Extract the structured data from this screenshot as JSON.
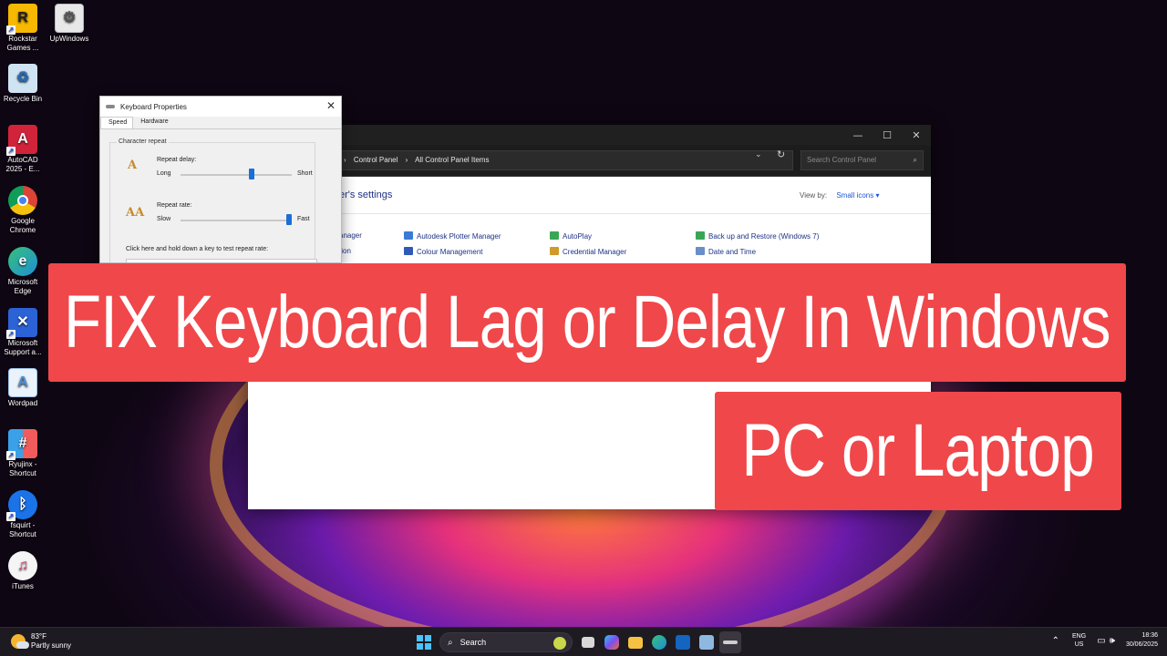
{
  "desktop": {
    "icons": [
      {
        "label": "Rockstar Games ...",
        "icon": "rockstar-icon",
        "color": "#f6b800"
      },
      {
        "label": "UpWindows",
        "icon": "gear-app-icon",
        "color": "#e8e8e8"
      },
      {
        "label": "Recycle Bin",
        "icon": "recycle-bin-icon",
        "color": "#cfe3f3"
      },
      {
        "label": "AutoCAD 2025 - E...",
        "icon": "autocad-icon",
        "color": "#d1243a"
      },
      {
        "label": "Google Chrome",
        "icon": "chrome-icon",
        "color": "#2fa44f"
      },
      {
        "label": "Microsoft Edge",
        "icon": "edge-icon",
        "color": "#1f8fd6"
      },
      {
        "label": "Microsoft Support a...",
        "icon": "tools-icon",
        "color": "#2b63d6"
      },
      {
        "label": "Wordpad",
        "icon": "wordpad-icon",
        "color": "#4b8fd6"
      },
      {
        "label": "Ryujinx - Shortcut",
        "icon": "ryujinx-icon",
        "color": "#3aa0e8"
      },
      {
        "label": "fsquirt - Shortcut",
        "icon": "bluetooth-icon",
        "color": "#1a73e8"
      },
      {
        "label": "iTunes",
        "icon": "itunes-icon",
        "color": "#f5f5f5"
      }
    ]
  },
  "control_panel": {
    "breadcrumbs": [
      "Control Panel",
      "All Control Panel Items"
    ],
    "search_placeholder": "Search Control Panel",
    "heading": "er's settings",
    "view_by_label": "View by:",
    "view_by_value": "Small icons",
    "items": [
      {
        "label": "anager",
        "icon": "none"
      },
      {
        "label": "Autodesk Plotter Manager",
        "icon": "plotter-icon",
        "color": "#3a7bd5"
      },
      {
        "label": "AutoPlay",
        "icon": "autoplay-icon",
        "color": "#3aa655"
      },
      {
        "label": "Back up and Restore (Windows 7)",
        "icon": "backup-icon",
        "color": "#3aa655"
      },
      {
        "label": "tion",
        "icon": "none"
      },
      {
        "label": "Colour Management",
        "icon": "colour-management-icon",
        "color": "#2f5bb7"
      },
      {
        "label": "Credential Manager",
        "icon": "credential-manager-icon",
        "color": "#d19a2c"
      },
      {
        "label": "Date and Time",
        "icon": "date-time-icon",
        "color": "#6a8fc8"
      }
    ]
  },
  "keyboard_dialog": {
    "title": "Keyboard Properties",
    "tabs": [
      "Speed",
      "Hardware"
    ],
    "group_label": "Character repeat",
    "repeat_delay": {
      "label": "Repeat delay:",
      "min_label": "Long",
      "max_label": "Short",
      "value_fraction": 0.65
    },
    "repeat_rate": {
      "label": "Repeat rate:",
      "min_label": "Slow",
      "max_label": "Fast",
      "value_fraction": 1.0
    },
    "test_label": "Click here and hold down a key to test repeat rate:",
    "repeat_icon_text": "A",
    "rate_icon_text": "AA"
  },
  "banner": {
    "line1": "FIX Keyboard Lag or Delay In Windows",
    "line2": "PC or Laptop",
    "color": "#f0474a"
  },
  "taskbar": {
    "weather_temp": "83°F",
    "weather_desc": "Partly sunny",
    "search_label": "Search",
    "lang": "ENG",
    "region": "US",
    "time": "18:36",
    "date": "30/06/2025"
  }
}
